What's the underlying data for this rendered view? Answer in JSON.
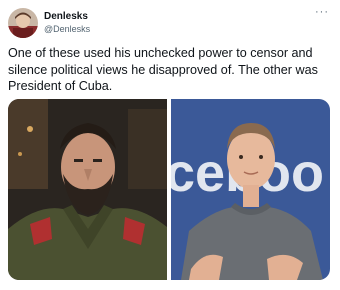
{
  "tweet": {
    "author_name": "Denlesks",
    "author_handle": "@Denlesks",
    "more_icon": "more-horizontal-icon",
    "more_label": "···",
    "text": "One of these used his unchecked power to censor and silence political views he disapproved of. The other was President of Cuba."
  },
  "media": {
    "photos": [
      {
        "label": "bearded man in military uniform"
      },
      {
        "label": "man in grey t-shirt in front of a blue logo",
        "background_text": "ceboo"
      }
    ]
  },
  "colors": {
    "text": "#0f1419",
    "secondary": "#536471",
    "logo_blue": "#3b5998"
  }
}
